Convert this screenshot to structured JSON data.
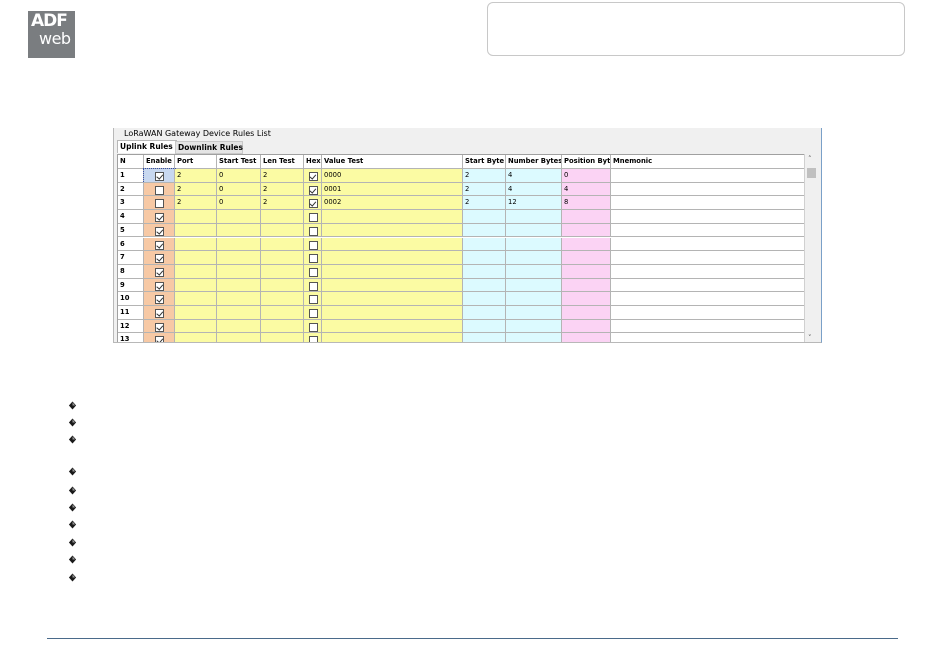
{
  "logo": {
    "line1": "ADF",
    "line2": "web"
  },
  "window": {
    "title": "LoRaWAN Gateway Device Rules List"
  },
  "tabs": [
    {
      "label": "Uplink Rules",
      "active": true
    },
    {
      "label": "Downlink Rules",
      "active": false
    }
  ],
  "columns": [
    "N",
    "Enable",
    "Port",
    "Start Test",
    "Len Test",
    "Hex",
    "Value Test",
    "Start Byte",
    "Number Bytes",
    "Position Byte",
    "Mnemonic"
  ],
  "rows": [
    {
      "n": "1",
      "enable": true,
      "port": "2",
      "start_test": "0",
      "len_test": "2",
      "hex": true,
      "value_test": "0000",
      "start_byte": "2",
      "number_bytes": "4",
      "position_byte": "0",
      "mnemonic": ""
    },
    {
      "n": "2",
      "enable": false,
      "port": "2",
      "start_test": "0",
      "len_test": "2",
      "hex": true,
      "value_test": "0001",
      "start_byte": "2",
      "number_bytes": "4",
      "position_byte": "4",
      "mnemonic": ""
    },
    {
      "n": "3",
      "enable": false,
      "port": "2",
      "start_test": "0",
      "len_test": "2",
      "hex": true,
      "value_test": "0002",
      "start_byte": "2",
      "number_bytes": "12",
      "position_byte": "8",
      "mnemonic": ""
    },
    {
      "n": "4",
      "enable": true,
      "port": "",
      "start_test": "",
      "len_test": "",
      "hex": false,
      "value_test": "",
      "start_byte": "",
      "number_bytes": "",
      "position_byte": "",
      "mnemonic": ""
    },
    {
      "n": "5",
      "enable": true,
      "port": "",
      "start_test": "",
      "len_test": "",
      "hex": false,
      "value_test": "",
      "start_byte": "",
      "number_bytes": "",
      "position_byte": "",
      "mnemonic": ""
    },
    {
      "n": "6",
      "enable": true,
      "port": "",
      "start_test": "",
      "len_test": "",
      "hex": false,
      "value_test": "",
      "start_byte": "",
      "number_bytes": "",
      "position_byte": "",
      "mnemonic": ""
    },
    {
      "n": "7",
      "enable": true,
      "port": "",
      "start_test": "",
      "len_test": "",
      "hex": false,
      "value_test": "",
      "start_byte": "",
      "number_bytes": "",
      "position_byte": "",
      "mnemonic": ""
    },
    {
      "n": "8",
      "enable": true,
      "port": "",
      "start_test": "",
      "len_test": "",
      "hex": false,
      "value_test": "",
      "start_byte": "",
      "number_bytes": "",
      "position_byte": "",
      "mnemonic": ""
    },
    {
      "n": "9",
      "enable": true,
      "port": "",
      "start_test": "",
      "len_test": "",
      "hex": false,
      "value_test": "",
      "start_byte": "",
      "number_bytes": "",
      "position_byte": "",
      "mnemonic": ""
    },
    {
      "n": "10",
      "enable": true,
      "port": "",
      "start_test": "",
      "len_test": "",
      "hex": false,
      "value_test": "",
      "start_byte": "",
      "number_bytes": "",
      "position_byte": "",
      "mnemonic": ""
    },
    {
      "n": "11",
      "enable": true,
      "port": "",
      "start_test": "",
      "len_test": "",
      "hex": false,
      "value_test": "",
      "start_byte": "",
      "number_bytes": "",
      "position_byte": "",
      "mnemonic": ""
    },
    {
      "n": "12",
      "enable": true,
      "port": "",
      "start_test": "",
      "len_test": "",
      "hex": false,
      "value_test": "",
      "start_byte": "",
      "number_bytes": "",
      "position_byte": "",
      "mnemonic": ""
    },
    {
      "n": "13",
      "enable": true,
      "port": "",
      "start_test": "",
      "len_test": "",
      "hex": false,
      "value_test": "",
      "start_byte": "",
      "number_bytes": "",
      "position_byte": "",
      "mnemonic": ""
    }
  ],
  "colors": {
    "enable": "#f7c9a5",
    "test": "#fbfba3",
    "byte": "#dcfaff",
    "position": "#fbd3f4"
  },
  "bullet_icon": "diamond-bullet-icon"
}
